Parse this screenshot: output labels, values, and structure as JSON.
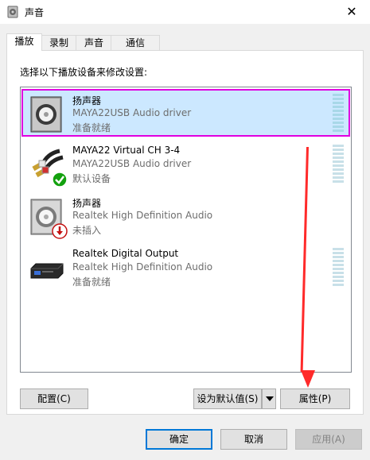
{
  "window": {
    "title": "声音",
    "close_glyph": "✕"
  },
  "tabs": [
    {
      "label": "播放",
      "active": true
    },
    {
      "label": "录制",
      "active": false
    },
    {
      "label": "声音",
      "active": false
    },
    {
      "label": "通信",
      "active": false
    }
  ],
  "playback": {
    "instructions": "选择以下播放设备来修改设置:",
    "devices": [
      {
        "name": "扬声器",
        "driver": "MAYA22USB Audio driver",
        "status": "准备就绪",
        "icon": "speaker-icon",
        "selected": true
      },
      {
        "name": "MAYA22 Virtual CH 3-4",
        "driver": "MAYA22USB Audio driver",
        "status": "默认设备",
        "icon": "rca-cable-icon",
        "badge": "default-check-icon"
      },
      {
        "name": "扬声器",
        "driver": "Realtek High Definition Audio",
        "status": "未插入",
        "icon": "speaker-icon",
        "badge": "unplugged-icon"
      },
      {
        "name": "Realtek Digital Output",
        "driver": "Realtek High Definition Audio",
        "status": "准备就绪",
        "icon": "digital-output-icon"
      }
    ]
  },
  "buttons": {
    "configure": "配置(C)",
    "set_default": "设为默认值(S)",
    "properties": "属性(P)",
    "ok": "确定",
    "cancel": "取消",
    "apply": "应用(A)"
  },
  "colors": {
    "selection_bg": "#cce8ff",
    "highlight_outline": "#e000e0",
    "annotation_arrow": "#ff2a2a",
    "primary_border": "#0078d7"
  }
}
